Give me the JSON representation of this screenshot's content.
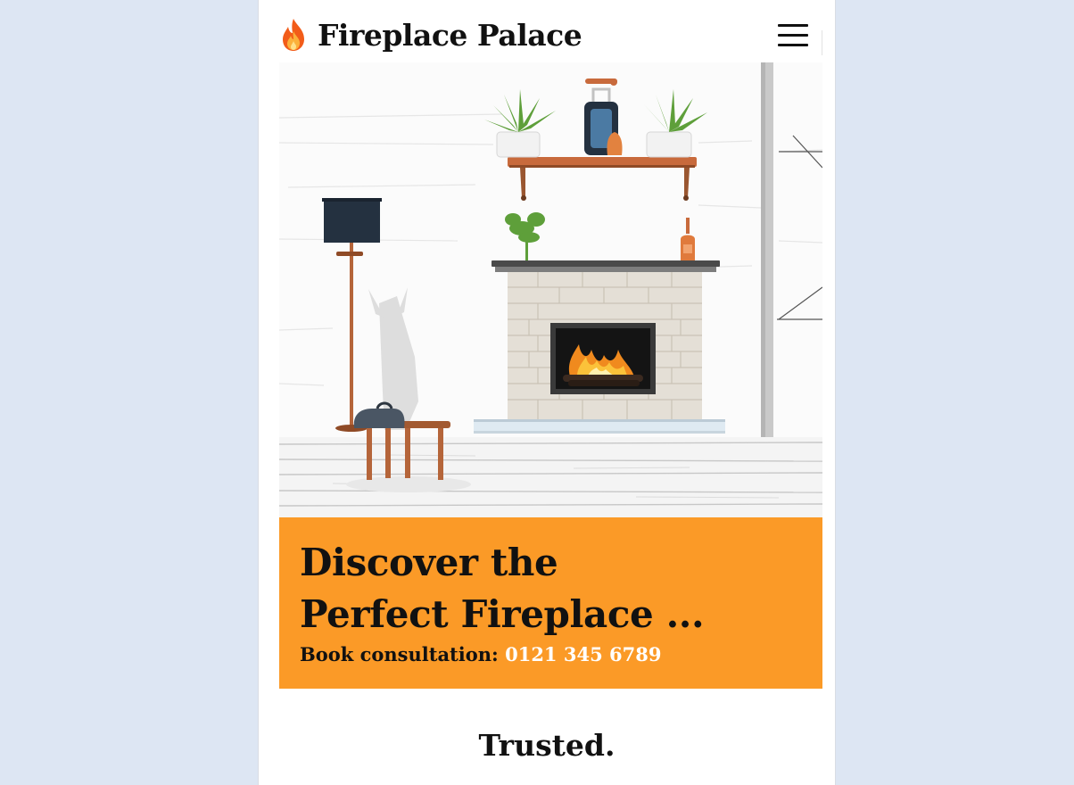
{
  "header": {
    "brand_name": "Fireplace Palace",
    "logo_icon": "flame-icon",
    "menu_icon": "hamburger-menu-icon"
  },
  "hero": {
    "image_subject": "living-room-fireplace-illustration"
  },
  "cta": {
    "headline_line1": "Discover the",
    "headline_line2": "Perfect Fireplace ...",
    "consultation_label": "Book consultation:",
    "phone": "0121 345 6789"
  },
  "section": {
    "trusted_heading": "Trusted."
  },
  "colors": {
    "page_background": "#dde6f3",
    "accent_orange": "#fb9a27",
    "text_dark": "#111111",
    "phone_text": "#ffffff"
  }
}
